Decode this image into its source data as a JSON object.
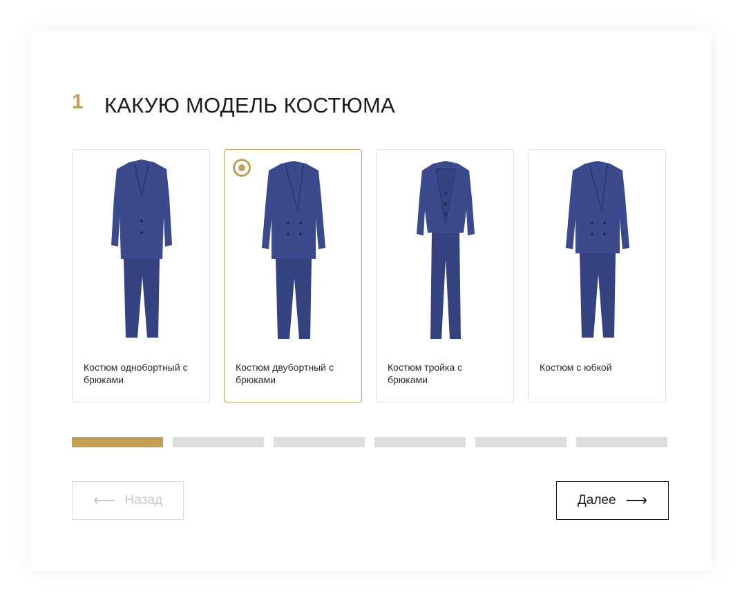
{
  "step": {
    "number": "1",
    "title": "КАКУЮ МОДЕЛЬ КОСТЮМА"
  },
  "options": [
    {
      "label": "Костюм однобортный с брюками",
      "selected": false,
      "image": "single-breasted-suit-icon"
    },
    {
      "label": "Костюм двубортный с брюками",
      "selected": true,
      "image": "double-breasted-suit-icon"
    },
    {
      "label": "Костюм тройка с брюками",
      "selected": false,
      "image": "three-piece-suit-icon"
    },
    {
      "label": "Костюм с юбкой",
      "selected": false,
      "image": "skirt-suit-icon"
    }
  ],
  "progress": {
    "total_steps": 6,
    "current_step": 1
  },
  "nav": {
    "back_label": "Назад",
    "next_label": "Далее",
    "back_icon": "arrow-left-icon",
    "next_icon": "arrow-right-icon"
  },
  "colors": {
    "accent": "#c19f55",
    "suit": "#3b4a8c",
    "inactive": "#dedede"
  }
}
